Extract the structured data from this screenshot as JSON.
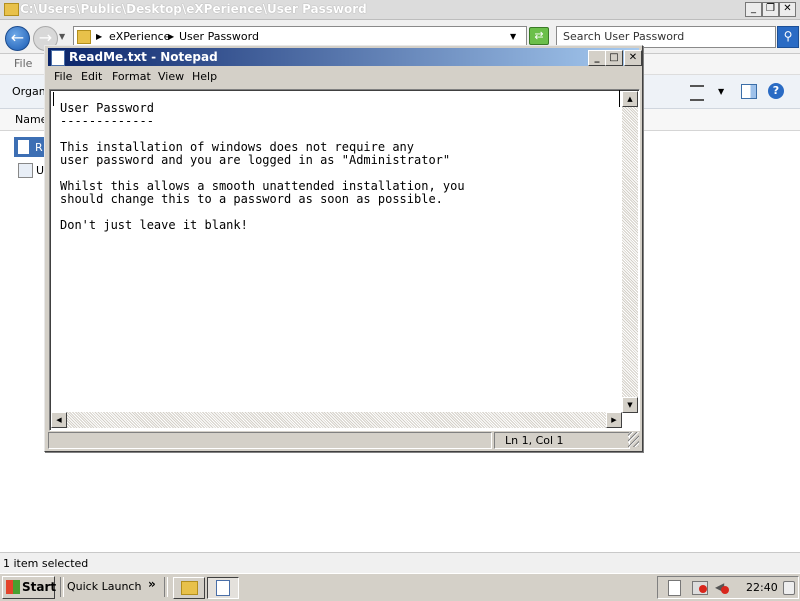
{
  "explorer": {
    "title": "C:\\Users\\Public\\Desktop\\eXPerience\\User Password",
    "address": {
      "segment1": "eXPerience",
      "segment2": "User Password"
    },
    "search_placeholder": "Search User Password",
    "menu_file": "File",
    "toolbar_organize": "Organi",
    "column_name": "Name",
    "file1_label": "R",
    "file2_label": "U",
    "status": "1 item selected"
  },
  "notepad": {
    "title": "ReadMe.txt - Notepad",
    "menu": {
      "file": "File",
      "edit": "Edit",
      "format": "Format",
      "view": "View",
      "help": "Help"
    },
    "content": "User Password\n-------------\n\nThis installation of windows does not require any\nuser password and you are logged in as \"Administrator\"\n\nWhilst this allows a smooth unattended installation, you\nshould change this to a password as soon as possible.\n\nDon't just leave it blank!",
    "status_position": "Ln 1, Col 1"
  },
  "taskbar": {
    "start_label": "Start",
    "quick_launch_label": "Quick Launch",
    "overflow_chevron": "»",
    "clock": "22:40"
  }
}
